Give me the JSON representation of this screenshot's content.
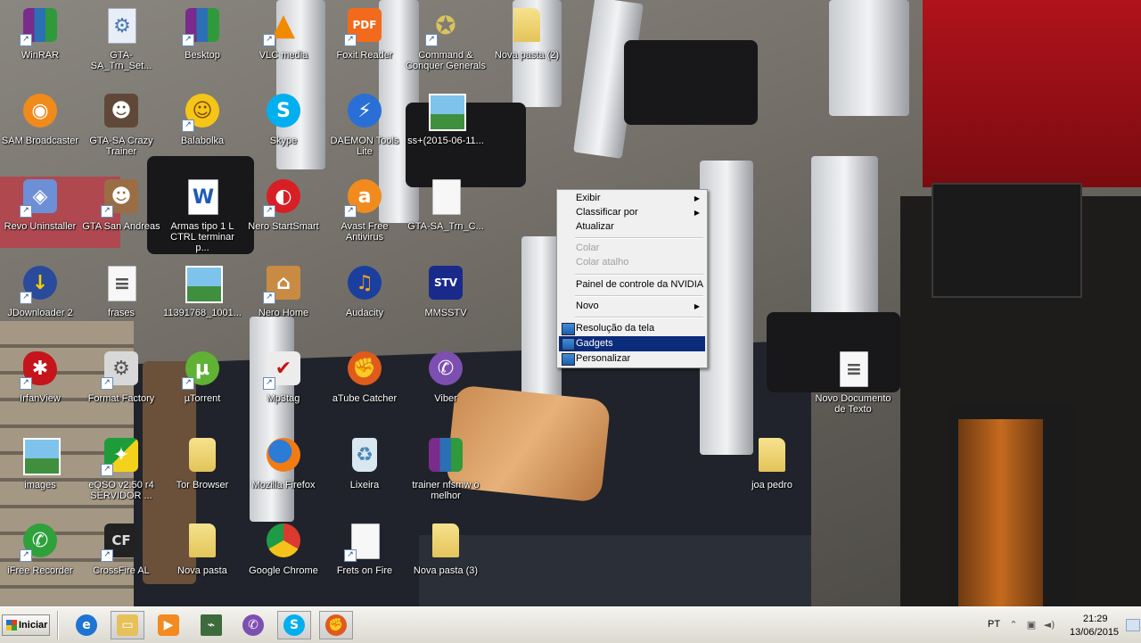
{
  "desktop": {
    "icons": [
      {
        "label": "WinRAR",
        "icon": "winrar-icon"
      },
      {
        "label": "GTA-SA_Trn_Set...",
        "icon": "setup-icon"
      },
      {
        "label": "Besktop",
        "icon": "winrar-icon"
      },
      {
        "label": "VLC media",
        "icon": "vlc-icon"
      },
      {
        "label": "Foxit Reader",
        "icon": "foxit-icon"
      },
      {
        "label": "Command & Conquer Generals",
        "icon": "cnc-icon"
      },
      {
        "label": "Nova pasta (2)",
        "icon": "folder-icon"
      },
      {
        "label": "SAM Broadcaster",
        "icon": "sam-broadcaster-icon"
      },
      {
        "label": "GTA-SA Crazy Trainer",
        "icon": "gta-trainer-icon"
      },
      {
        "label": "Balabolka",
        "icon": "balabolka-icon"
      },
      {
        "label": "Skype",
        "icon": "skype-icon"
      },
      {
        "label": "DAEMON Tools Lite",
        "icon": "daemon-tools-icon"
      },
      {
        "label": "ss+(2015-06-11...",
        "icon": "image-file-icon"
      },
      {
        "label": "Revo Uninstaller",
        "icon": "revo-icon"
      },
      {
        "label": "GTA San Andreas",
        "icon": "gta-sa-icon"
      },
      {
        "label": "Armas tipo 1 L CTRL terminar p...",
        "icon": "word-doc-icon"
      },
      {
        "label": "Nero StartSmart",
        "icon": "nero-icon"
      },
      {
        "label": "Avast Free Antivirus",
        "icon": "avast-icon"
      },
      {
        "label": "GTA-SA_Trn_C...",
        "icon": "blank-file-icon"
      },
      {
        "label": "JDownloader 2",
        "icon": "jdownloader-icon"
      },
      {
        "label": "frases",
        "icon": "text-file-icon"
      },
      {
        "label": "11391768_1001...",
        "icon": "image-file-icon"
      },
      {
        "label": "Nero Home",
        "icon": "nero-home-icon"
      },
      {
        "label": "Audacity",
        "icon": "audacity-icon"
      },
      {
        "label": "MMSSTV",
        "icon": "mmsstv-icon"
      },
      {
        "label": "IrfanView",
        "icon": "irfanview-icon"
      },
      {
        "label": "Format Factory",
        "icon": "format-factory-icon"
      },
      {
        "label": "µTorrent",
        "icon": "utorrent-icon"
      },
      {
        "label": "Mp3tag",
        "icon": "mp3tag-icon"
      },
      {
        "label": "aTube Catcher",
        "icon": "atube-catcher-icon"
      },
      {
        "label": "Viber",
        "icon": "viber-icon"
      },
      {
        "label": "Novo Documento de Texto",
        "icon": "text-file-icon"
      },
      {
        "label": "images",
        "icon": "image-file-icon"
      },
      {
        "label": "eQSO v2.50 r4 SERVIDOR ...",
        "icon": "eqso-icon"
      },
      {
        "label": "Tor Browser",
        "icon": "folder-icon"
      },
      {
        "label": "Mozilla Firefox",
        "icon": "firefox-icon"
      },
      {
        "label": "Lixeira",
        "icon": "recycle-bin-icon"
      },
      {
        "label": "trainer nfsmw o melhor",
        "icon": "winrar-icon"
      },
      {
        "label": "joa pedro",
        "icon": "folder-icon"
      },
      {
        "label": "iFree Recorder",
        "icon": "ifree-recorder-icon"
      },
      {
        "label": "CrossFire AL",
        "icon": "crossfire-icon"
      },
      {
        "label": "Nova pasta",
        "icon": "folder-icon"
      },
      {
        "label": "Google Chrome",
        "icon": "chrome-icon"
      },
      {
        "label": "Frets on Fire",
        "icon": "blank-file-icon"
      },
      {
        "label": "Nova pasta (3)",
        "icon": "folder-icon"
      }
    ],
    "glyphs": {
      "foxit": "PDF",
      "mmsstv": "STV",
      "crossfire": "CF",
      "word": "W",
      "skype": "S",
      "utorrent": "µ"
    }
  },
  "context_menu": {
    "items": [
      {
        "label": "Exibir",
        "submenu": true,
        "disabled": false
      },
      {
        "label": "Classificar por",
        "submenu": true,
        "disabled": false
      },
      {
        "label": "Atualizar",
        "submenu": false,
        "disabled": false
      },
      {
        "label": "Colar",
        "submenu": false,
        "disabled": true
      },
      {
        "label": "Colar atalho",
        "submenu": false,
        "disabled": true
      },
      {
        "label": "Painel de controle da NVIDIA",
        "submenu": false,
        "disabled": false
      },
      {
        "label": "Novo",
        "submenu": true,
        "disabled": false
      },
      {
        "label": "Resolução da tela",
        "submenu": false,
        "disabled": false,
        "icon": "display-icon"
      },
      {
        "label": "Gadgets",
        "submenu": false,
        "disabled": false,
        "icon": "gadgets-icon",
        "highlighted": true
      },
      {
        "label": "Personalizar",
        "submenu": false,
        "disabled": false,
        "icon": "personalize-icon"
      }
    ],
    "highlight_color": "#0b2c7a"
  },
  "taskbar": {
    "start_label": "Iniciar",
    "pinned": [
      {
        "name": "internet-explorer",
        "icon": "ie-icon"
      },
      {
        "name": "windows-explorer",
        "icon": "explorer-icon"
      },
      {
        "name": "media-player",
        "icon": "media-player-icon"
      },
      {
        "name": "task-manager",
        "icon": "task-manager-icon"
      },
      {
        "name": "viber",
        "icon": "viber-icon"
      },
      {
        "name": "skype",
        "icon": "skype-icon"
      },
      {
        "name": "atube-catcher",
        "icon": "atube-catcher-icon"
      }
    ],
    "tray": {
      "language": "PT",
      "time": "21:29",
      "date": "13/06/2015"
    }
  }
}
